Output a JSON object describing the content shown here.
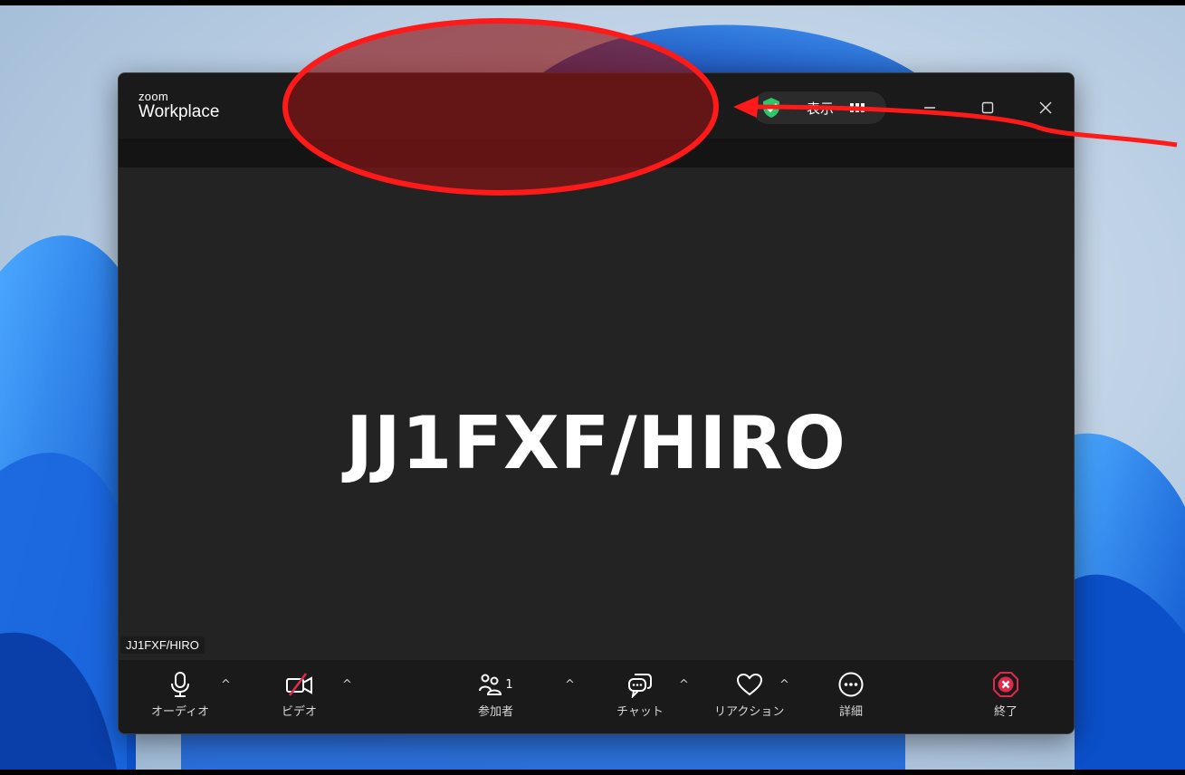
{
  "window": {
    "logo_small": "zoom",
    "logo_big": "Workplace",
    "view_label": "表示",
    "minimize_label": "—",
    "maximize_label": "☐",
    "close_label": "✕"
  },
  "meeting": {
    "display_name": "JJ1FXF/HIRO",
    "name_tag": "JJ1FXF/HIRO"
  },
  "toolbar": {
    "audio_label": "オーディオ",
    "video_label": "ビデオ",
    "participants_label": "参加者",
    "participants_count": "1",
    "chat_label": "チャット",
    "reactions_label": "リアクション",
    "more_label": "詳細",
    "end_label": "終了",
    "caret": "^"
  },
  "colors": {
    "window_bg": "#232323",
    "titlebar_bg": "#1a1a1a",
    "shield_green": "#2fc66b",
    "end_red": "#e02a4b",
    "annotation_red": "#ff0000"
  }
}
